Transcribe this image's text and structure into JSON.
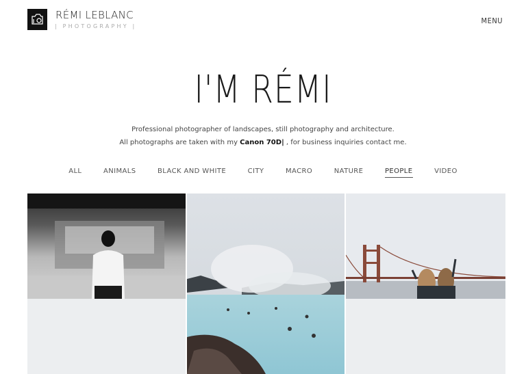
{
  "brand": {
    "name": "RÉMI LEBLANC",
    "tagline": "| PHOTOGRAPHY |"
  },
  "nav": {
    "menu_label": "MENU"
  },
  "hero": {
    "title": "I'M RÉMI",
    "line1": "Professional photographer of landscapes, still photography and architecture.",
    "line2_before": "All photographs are taken with my ",
    "camera": "Canon 70D|",
    "line2_after": " , for business inquiries contact me."
  },
  "filters": [
    {
      "label": "ALL",
      "active": false
    },
    {
      "label": "ANIMALS",
      "active": false
    },
    {
      "label": "BLACK AND WHITE",
      "active": false
    },
    {
      "label": "CITY",
      "active": false
    },
    {
      "label": "MACRO",
      "active": false
    },
    {
      "label": "NATURE",
      "active": false
    },
    {
      "label": "PEOPLE",
      "active": true
    },
    {
      "label": "VIDEO",
      "active": false
    }
  ],
  "gallery": {
    "photos": [
      {
        "subject": "woman at subway platform (black and white)"
      },
      {
        "subject": "blue lagoon geothermal spa with bathers"
      },
      {
        "subject": "two friends in front of golden gate bridge"
      }
    ]
  },
  "colors": {
    "text": "#222222",
    "muted": "#aaaaaa",
    "placeholder": "#eceef0"
  }
}
